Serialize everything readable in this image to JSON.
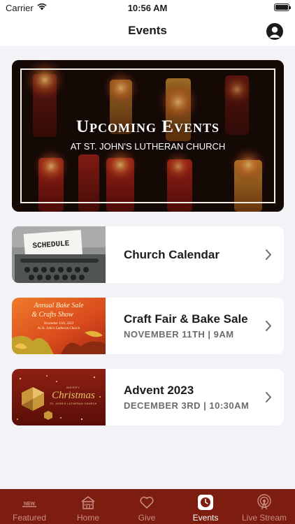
{
  "status_bar": {
    "carrier": "Carrier",
    "time": "10:56 AM"
  },
  "nav": {
    "title": "Events"
  },
  "hero": {
    "title": "Upcoming Events",
    "subtitle": "AT ST. JOHN'S LUTHERAN CHURCH"
  },
  "events": [
    {
      "title": "Church Calendar",
      "meta": "",
      "thumb_text": "SCHEDULE"
    },
    {
      "title": "Craft Fair & Bake Sale",
      "meta": "NOVEMBER 11TH | 9AM",
      "thumb_lines": [
        "Annual Bake Sale",
        "& Crafts Show",
        "November 11th, 2023",
        "At St. John's Lutheran Church"
      ]
    },
    {
      "title": "Advent 2023",
      "meta": "DECEMBER 3RD | 10:30AM",
      "thumb_lines": [
        "MERRY",
        "Christmas",
        "ST. JOHN'S LUTHERAN CHURCH"
      ]
    }
  ],
  "tabs": [
    {
      "label": "Featured",
      "icon": "new-badge-icon",
      "badge": "NEW"
    },
    {
      "label": "Home",
      "icon": "church-icon"
    },
    {
      "label": "Give",
      "icon": "heart-icon"
    },
    {
      "label": "Events",
      "icon": "clock-icon"
    },
    {
      "label": "Live Stream",
      "icon": "broadcast-icon"
    }
  ],
  "active_tab": "Events",
  "colors": {
    "tab_bar": "#7d1d10",
    "tab_inactive": "#c98c82",
    "tab_active": "#ffffff",
    "background": "#f2f2f7"
  }
}
